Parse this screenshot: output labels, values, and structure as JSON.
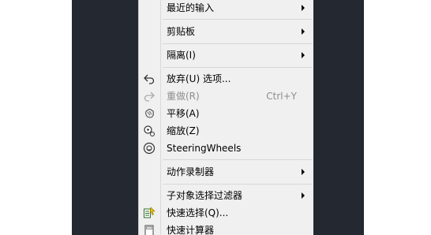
{
  "menu": {
    "items": [
      {
        "label": "最近的输入",
        "submenu": true
      },
      {
        "label": "剪贴板",
        "submenu": true
      },
      {
        "label": "隔离(I)",
        "submenu": true
      },
      {
        "label": "放弃(U) 选项...",
        "icon": "undo-arrow-icon"
      },
      {
        "label": "重做(R)",
        "shortcut": "Ctrl+Y",
        "disabled": true,
        "icon": "redo-arrow-icon"
      },
      {
        "label": "平移(A)",
        "icon": "pan-hand-icon"
      },
      {
        "label": "缩放(Z)",
        "icon": "zoom-magnifier-icon"
      },
      {
        "label": "SteeringWheels",
        "icon": "steering-wheel-icon"
      },
      {
        "label": "动作录制器",
        "submenu": true
      },
      {
        "label": "子对象选择过滤器",
        "submenu": true
      },
      {
        "label": "快速选择(Q)...",
        "icon": "quick-select-icon"
      },
      {
        "label": "快速计算器",
        "icon": "calculator-icon"
      }
    ]
  }
}
